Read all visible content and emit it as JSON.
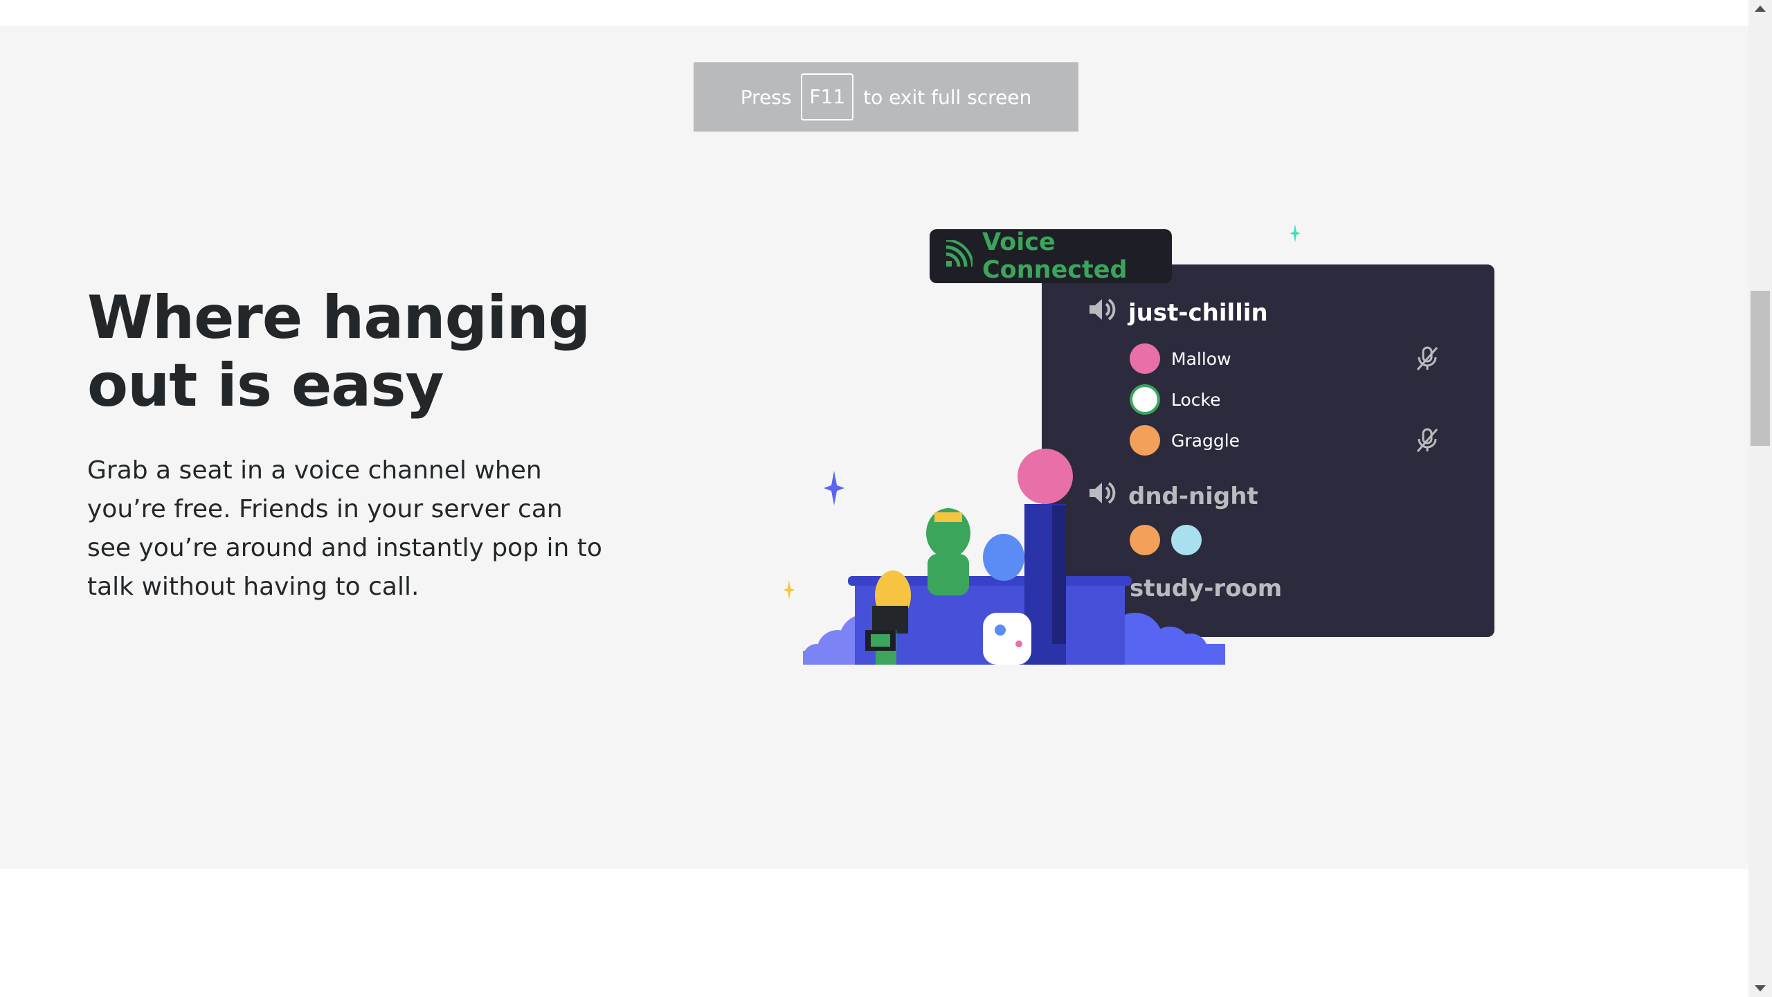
{
  "fullscreen_notice": {
    "press": "Press",
    "key": "F11",
    "suffix": "to exit full screen"
  },
  "feature": {
    "headline_line1": "Where hanging",
    "headline_line2": "out is easy",
    "body": "Grab a seat in a voice channel when you’re free. Friends in your server can see you’re around and instantly pop in to talk without having to call."
  },
  "voice_panel": {
    "status": "Voice Connected",
    "channels": [
      {
        "name": "just-chillin",
        "users": [
          {
            "name": "Mallow",
            "muted": true,
            "avatar_color": "#e86fa8"
          },
          {
            "name": "Locke",
            "muted": false,
            "avatar_color": "#ffffff"
          },
          {
            "name": "Graggle",
            "muted": true,
            "avatar_color": "#f2a05a"
          }
        ]
      },
      {
        "name": "dnd-night",
        "avatars": [
          "#f2a05a",
          "#a8e0f0"
        ]
      },
      {
        "name": "study-room"
      }
    ]
  },
  "colors": {
    "accent_green": "#3ba55c",
    "panel_bg": "#2b2b3d",
    "blurple": "#5865f2"
  },
  "icons": [
    "speaker-icon",
    "signal-icon",
    "mute-mic-icon",
    "sparkle-icon"
  ]
}
